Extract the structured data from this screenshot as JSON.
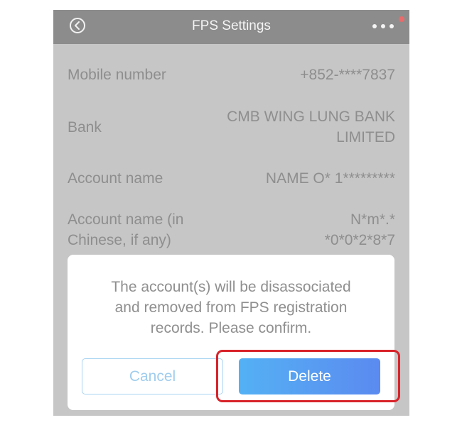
{
  "header": {
    "title": "FPS Settings",
    "back_icon": "chevron-left-circle-icon",
    "more_icon": "more-horizontal-icon"
  },
  "details": [
    {
      "label": "Mobile number",
      "value": [
        "+852-****7837"
      ]
    },
    {
      "label": "Bank",
      "value": [
        "CMB WING LUNG BANK",
        "LIMITED"
      ]
    },
    {
      "label": "Account name",
      "value": [
        "NAME O* 1*********"
      ]
    },
    {
      "label": [
        "Account name (in",
        "Chinese, if any)"
      ],
      "value": [
        "N*m*.*",
        "*0*0*2*8*7"
      ]
    }
  ],
  "dialog": {
    "message": [
      "The account(s) will be disassociated",
      "and removed from FPS registration",
      "records. Please confirm."
    ],
    "cancel_label": "Cancel",
    "delete_label": "Delete"
  },
  "colors": {
    "overlay": "#c6c6c6",
    "navbar": "#8c8c8c",
    "primary_gradient_start": "#54b1f4",
    "primary_gradient_end": "#5b8af0",
    "highlight": "#d8232a",
    "notification": "#e96b6b"
  }
}
